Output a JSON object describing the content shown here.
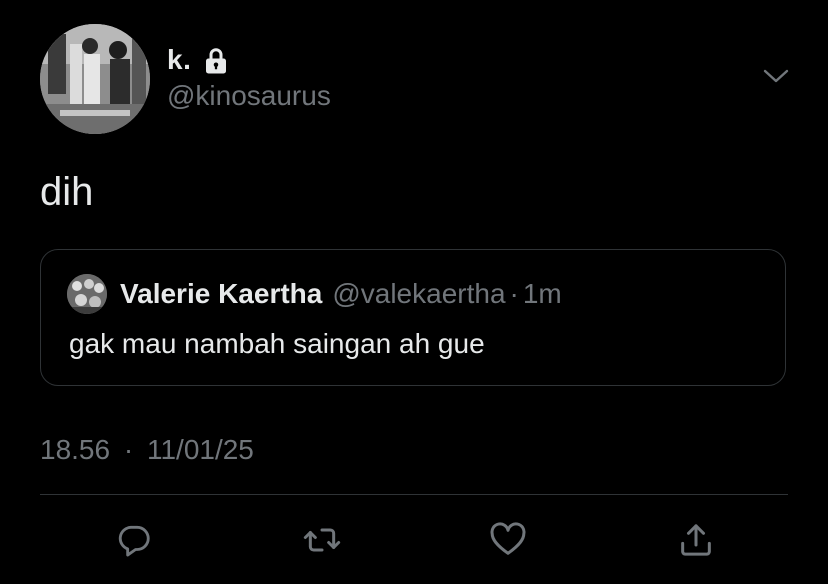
{
  "author": {
    "display_name": "k.",
    "handle": "@kinosaurus",
    "avatar_icon": "profile-photo",
    "protected_icon": "lock-icon"
  },
  "menu_icon": "chevron-down-icon",
  "tweet": {
    "text": "dih"
  },
  "quoted_tweet": {
    "display_name": "Valerie Kaertha",
    "handle": "@valekaertha",
    "separator": "·",
    "age": "1m",
    "text": "gak mau nambah saingan ah gue"
  },
  "meta": {
    "time": "18.56",
    "separator": "·",
    "date": "11/01/25"
  },
  "actions": [
    {
      "name": "reply",
      "icon": "reply-icon"
    },
    {
      "name": "retweet",
      "icon": "retweet-icon"
    },
    {
      "name": "like",
      "icon": "heart-icon"
    },
    {
      "name": "share",
      "icon": "share-icon"
    }
  ],
  "colors": {
    "background": "#000000",
    "primary_text": "#e7e9ea",
    "secondary_text": "#71767b",
    "border": "#2f3336"
  }
}
